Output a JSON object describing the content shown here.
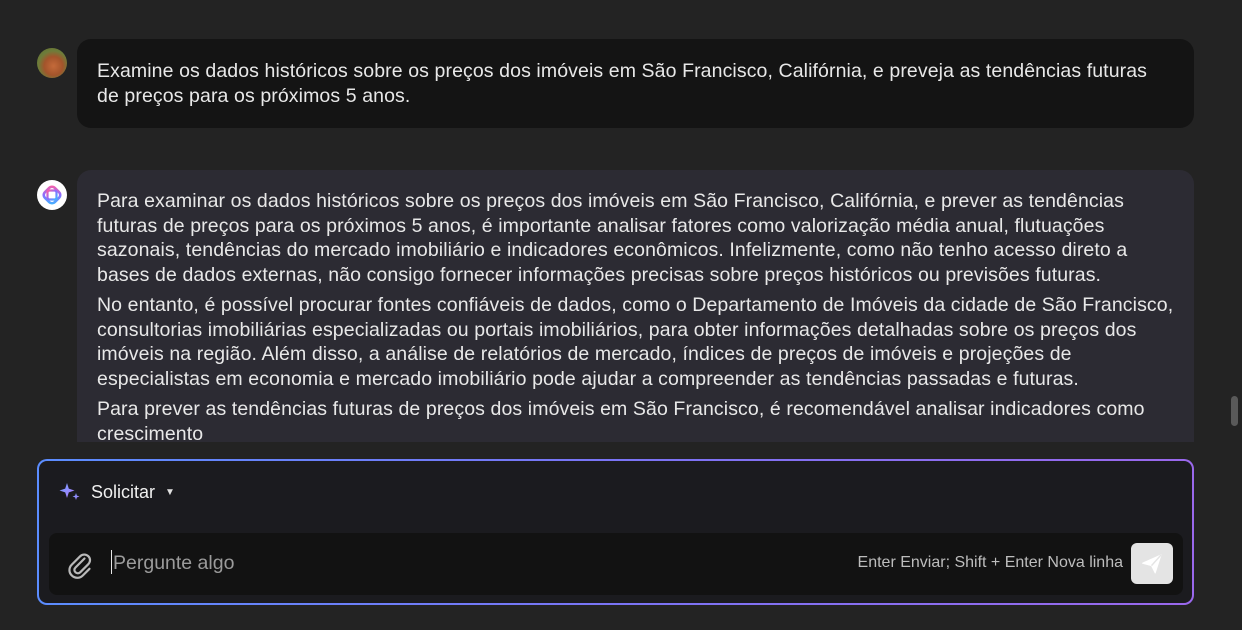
{
  "conversation": {
    "user_message": {
      "text": "Examine os dados históricos sobre os preços dos imóveis em São Francisco, Califórnia, e preveja as tendências futuras de preços para os próximos 5 anos."
    },
    "assistant_message": {
      "paragraphs": [
        "Para examinar os dados históricos sobre os preços dos imóveis em São Francisco, Califórnia, e prever as tendências futuras de preços para os próximos 5 anos, é importante analisar fatores como valorização média anual, flutuações sazonais, tendências do mercado imobiliário e indicadores econômicos. Infelizmente, como não tenho acesso direto a bases de dados externas, não consigo fornecer informações precisas sobre preços históricos ou previsões futuras.",
        "No entanto, é possível procurar fontes confiáveis de dados, como o Departamento de Imóveis da cidade de São Francisco, consultorias imobiliárias especializadas ou portais imobiliários, para obter informações detalhadas sobre os preços dos imóveis na região. Além disso, a análise de relatórios de mercado, índices de preços de imóveis e projeções de especialistas em economia e mercado imobiliário pode ajudar a compreender as tendências passadas e futuras.",
        "Para prever as tendências futuras de preços dos imóveis em São Francisco, é recomendável analisar indicadores como crescimento"
      ]
    }
  },
  "composer": {
    "mode_label": "Solicitar",
    "mode_caret": "▼",
    "placeholder": "Pergunte algo",
    "value": "",
    "shortcut_hint": "Enter Enviar; Shift + Enter Nova linha"
  },
  "icons": {
    "user_avatar": "user-avatar",
    "assistant_avatar": "assistant-logo-icon",
    "sparkle": "sparkle-icon",
    "attach": "paperclip-icon",
    "send": "send-icon"
  },
  "colors": {
    "background": "#232323",
    "user_bubble": "#141414",
    "assistant_bubble": "#2c2b33",
    "composer_border_start": "#5b8dff",
    "composer_border_end": "#9a68ec",
    "send_button": "#e4e4e4"
  }
}
